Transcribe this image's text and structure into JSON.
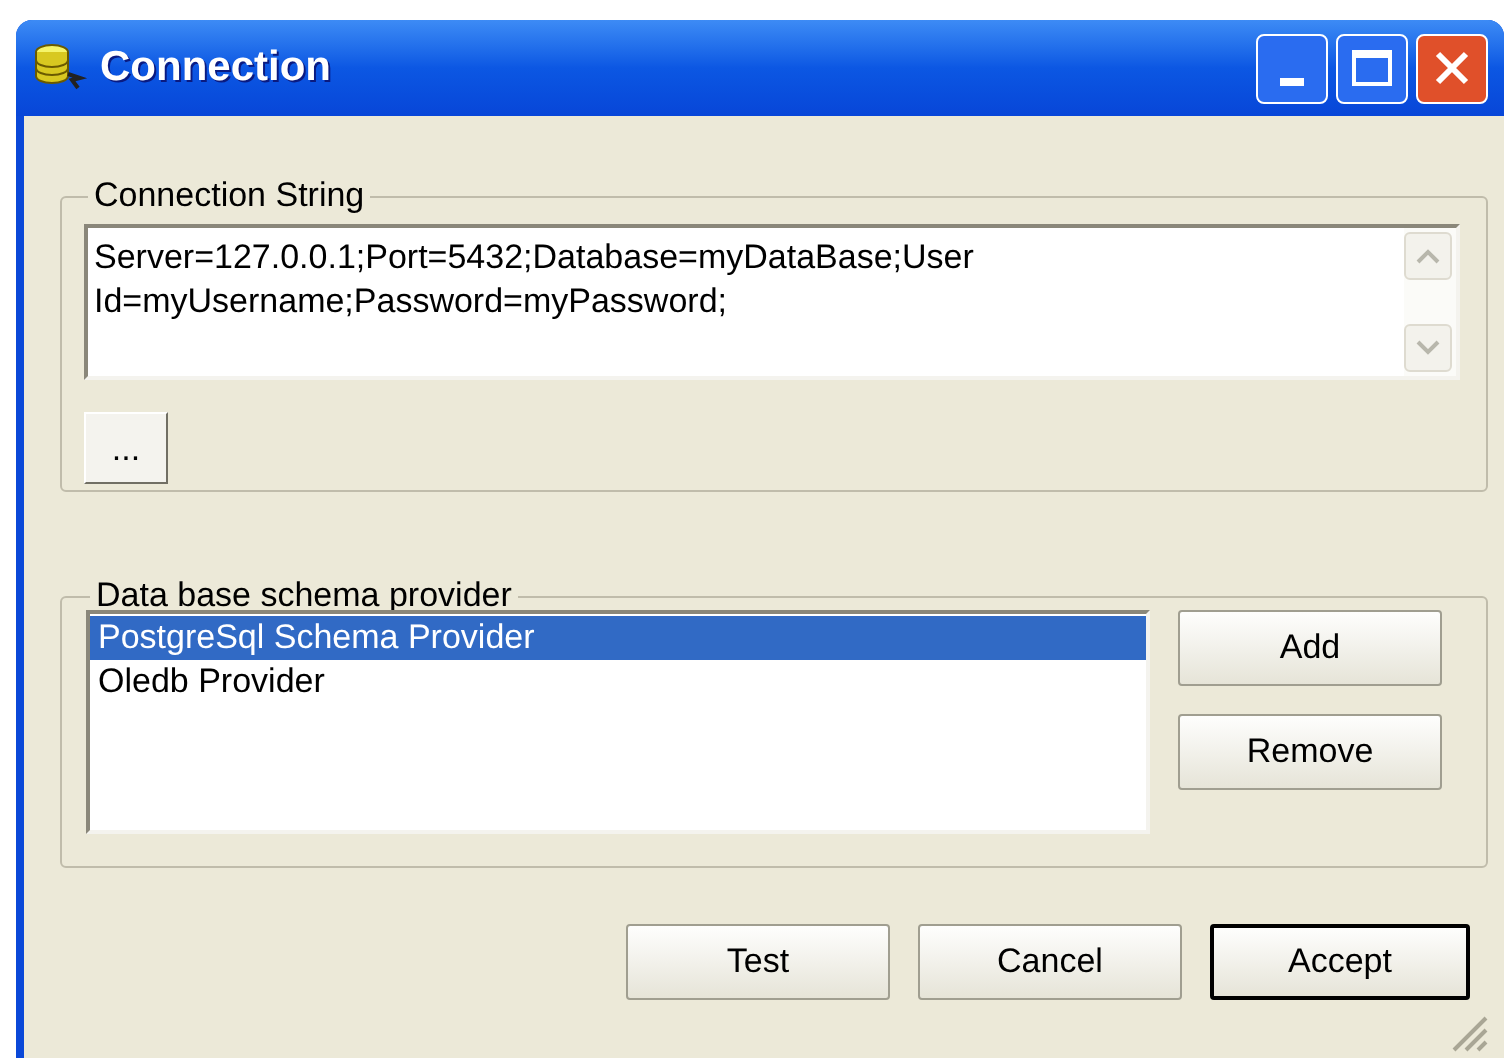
{
  "window": {
    "title": "Connection"
  },
  "connection_string": {
    "label": "Connection String",
    "value": "Server=127.0.0.1;Port=5432;Database=myDataBase;User Id=myUsername;Password=myPassword;",
    "browse_button": "..."
  },
  "schema_provider": {
    "label": "Data base schema provider",
    "providers": [
      {
        "name": "PostgreSql Schema Provider",
        "selected": true
      },
      {
        "name": "Oledb Provider",
        "selected": false
      }
    ],
    "buttons": [
      "Add",
      "Remove"
    ]
  },
  "footer_buttons": [
    {
      "label": "Test",
      "default": false
    },
    {
      "label": "Cancel",
      "default": false
    },
    {
      "label": "Accept",
      "default": true
    }
  ]
}
